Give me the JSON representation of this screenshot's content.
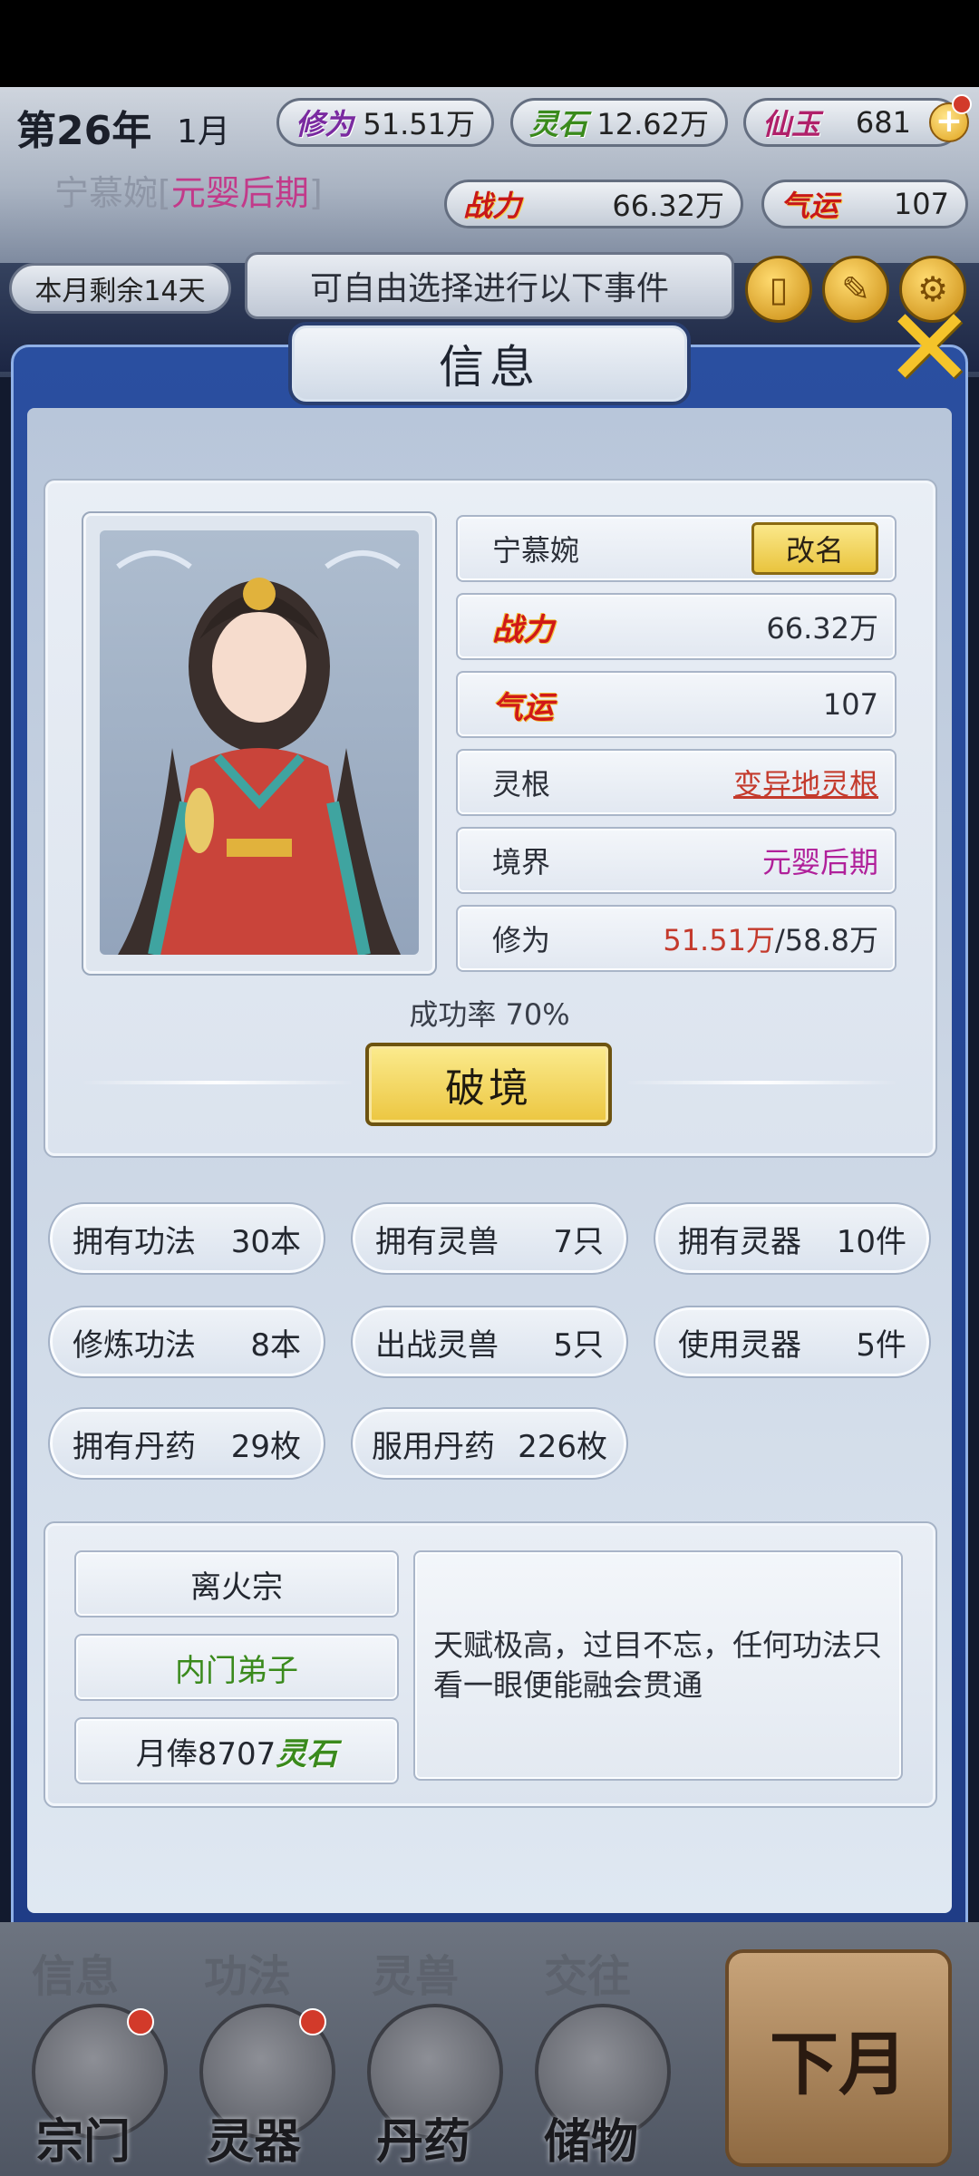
{
  "header": {
    "year": "第26年",
    "month": "1月",
    "cultivation": {
      "label": "修为",
      "value": "51.51万"
    },
    "spirit_stone": {
      "label": "灵石",
      "value": "12.62万"
    },
    "immortal_jade": {
      "label": "仙玉",
      "value": "681"
    },
    "character_name": "宁慕婉",
    "character_realm": "元婴后期",
    "combat_power": {
      "label": "战力",
      "value": "66.32万"
    },
    "luck": {
      "label": "气运",
      "value": "107"
    },
    "days_remaining": "本月剩余14天",
    "event_prompt": "可自由选择进行以下事件"
  },
  "panel": {
    "title": "信息",
    "name": "宁慕婉",
    "rename_label": "改名",
    "rows": {
      "combat": {
        "label": "战力",
        "value": "66.32万"
      },
      "luck": {
        "label": "气运",
        "value": "107"
      },
      "root": {
        "label": "灵根",
        "value": "变异地灵根"
      },
      "realm": {
        "label": "境界",
        "value": "元婴后期"
      },
      "cultivation": {
        "label": "修为",
        "current": "51.51万",
        "max": "/58.8万"
      }
    },
    "success_rate": "成功率 70%",
    "breakthrough_label": "破境",
    "stats": [
      {
        "label": "拥有功法",
        "value": "30本"
      },
      {
        "label": "拥有灵兽",
        "value": "7只"
      },
      {
        "label": "拥有灵器",
        "value": "10件"
      },
      {
        "label": "修炼功法",
        "value": "8本"
      },
      {
        "label": "出战灵兽",
        "value": "5只"
      },
      {
        "label": "使用灵器",
        "value": "5件"
      },
      {
        "label": "拥有丹药",
        "value": "29枚"
      },
      {
        "label": "服用丹药",
        "value": "226枚"
      }
    ],
    "sect": {
      "name": "离火宗",
      "rank": "内门弟子",
      "salary_prefix": "月俸8707",
      "salary_unit": "灵石",
      "description": "天赋极高，过目不忘，任何功法只看一眼便能融会贯通"
    }
  },
  "bottom_nav": {
    "top_row": [
      "信息",
      "功法",
      "灵兽",
      "交往"
    ],
    "items": [
      "宗门",
      "灵器",
      "丹药",
      "储物"
    ],
    "next_month": "下月"
  },
  "colors": {
    "accent_gold": "#ecc640",
    "panel_blue": "#1f3c86",
    "emphasis_red": "#c43a2c",
    "realm_magenta": "#b0209a",
    "rank_green": "#3a8a1c"
  }
}
